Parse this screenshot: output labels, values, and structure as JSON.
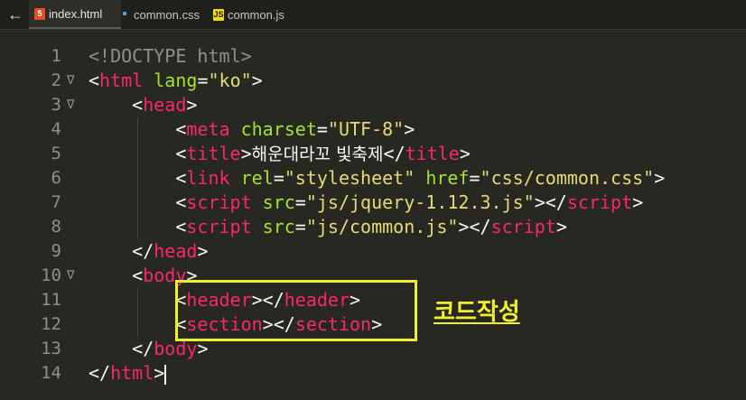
{
  "tabs": {
    "back_symbol": "←",
    "items": [
      {
        "label": "index.html",
        "icon": "html5-icon",
        "active": true
      },
      {
        "label": "common.css",
        "icon": "css3-icon",
        "active": false
      },
      {
        "label": "common.js",
        "icon": "javascript-icon",
        "active": false
      }
    ]
  },
  "editor": {
    "line_numbers": [
      "1",
      "2",
      "3",
      "4",
      "5",
      "6",
      "7",
      "8",
      "9",
      "10",
      "11",
      "12",
      "13",
      "14"
    ],
    "fold_marker": "∇",
    "lines": {
      "l1": {
        "doctype": "<!DOCTYPE html>"
      },
      "l2": {
        "open": "<",
        "tag": "html",
        "attr": "lang",
        "eq": "=",
        "val": "\"ko\"",
        "close": ">"
      },
      "l3": {
        "open": "<",
        "tag": "head",
        "close": ">"
      },
      "l4": {
        "open": "<",
        "tag": "meta",
        "attr": "charset",
        "eq": "=",
        "val": "\"UTF-8\"",
        "close": ">"
      },
      "l5": {
        "open": "<",
        "tag": "title",
        "close": ">",
        "text": "해운대라꼬 빛축제",
        "open2": "</",
        "tag2": "title",
        "close2": ">"
      },
      "l6": {
        "open": "<",
        "tag": "link",
        "attr1": "rel",
        "eq1": "=",
        "val1": "\"stylesheet\"",
        "attr2": "href",
        "eq2": "=",
        "val2": "\"css/common.css\"",
        "close": ">"
      },
      "l7": {
        "open": "<",
        "tag": "script",
        "attr": "src",
        "eq": "=",
        "val": "\"js/jquery-1.12.3.js\"",
        "close": ">",
        "open2": "</",
        "tag2": "script",
        "close2": ">"
      },
      "l8": {
        "open": "<",
        "tag": "script",
        "attr": "src",
        "eq": "=",
        "val": "\"js/common.js\"",
        "close": ">",
        "open2": "</",
        "tag2": "script",
        "close2": ">"
      },
      "l9": {
        "open": "</",
        "tag": "head",
        "close": ">"
      },
      "l10": {
        "open": "<",
        "tag": "body",
        "close": ">"
      },
      "l11": {
        "open": "<",
        "tag": "header",
        "close": ">",
        "open2": "</",
        "tag2": "header",
        "close2": ">"
      },
      "l12": {
        "open": "<",
        "tag": "section",
        "close": ">",
        "open2": "</",
        "tag2": "section",
        "close2": ">"
      },
      "l13": {
        "open": "</",
        "tag": "body",
        "close": ">"
      },
      "l14": {
        "open": "</",
        "tag": "html",
        "close": ">"
      }
    }
  },
  "annotation": {
    "label": "코드작성",
    "color": "#f3f02a"
  },
  "colors": {
    "background": "#272822",
    "tag": "#f92672",
    "attribute": "#a6e22e",
    "string": "#e6db74",
    "comment": "#8f908a"
  }
}
